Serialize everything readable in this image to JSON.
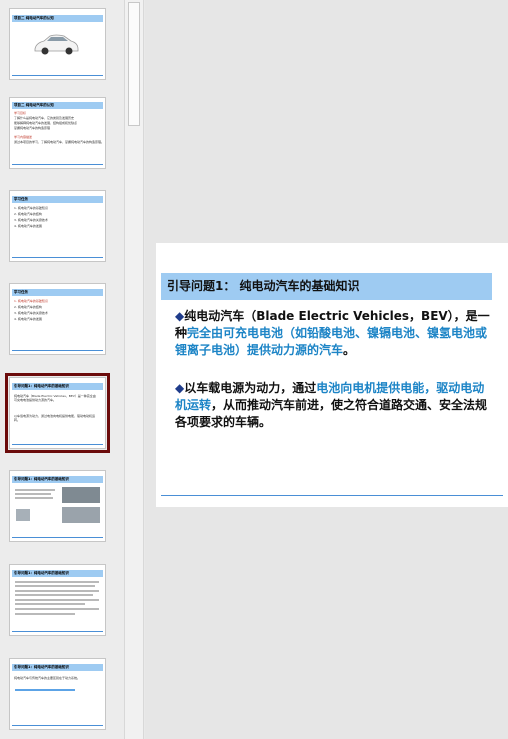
{
  "thumbnails": [
    {
      "title": "项目二 纯电动汽车的认知",
      "bullets": []
    },
    {
      "title": "项目二 纯电动汽车的认知",
      "bullets": [
        "学习目标",
        "了解什么是纯电动汽车、它的类别及发展历史",
        "能够解释纯电动汽车的发展、结构组成和优缺点",
        "掌握纯电动汽车的构造原理",
        "学习内容描述",
        "通过本项目的学习，了解纯电动汽车、掌握纯电动汽车的构造原理。"
      ]
    },
    {
      "title": "学习任务",
      "bullets": [
        "1. 纯电动汽车的基础知识",
        "2. 纯电动汽车的结构",
        "3. 纯电动汽车的关键技术",
        "4. 纯电动汽车的发展"
      ]
    },
    {
      "title": "学习任务",
      "bullets": [
        "1. 纯电动汽车的基础知识",
        "2. 纯电动汽车的结构",
        "3. 纯电动汽车的关键技术",
        "4. 纯电动汽车的发展"
      ]
    },
    {
      "title": "引导问题1：纯电动汽车的基础知识",
      "bullets": [
        "纯电动汽车（Blade Electric Vehicles，BEV）是一种完全由可充电电池提供动力源的汽车。",
        "以车载电源为动力，通过电池向电机提供电能，驱动电动机运转。"
      ]
    },
    {
      "title": "引导问题1：纯电动汽车的基础知识",
      "bullets": []
    },
    {
      "title": "引导问题1：纯电动汽车的基础知识",
      "bullets": []
    },
    {
      "title": "引导问题1：纯电动汽车的基础知识",
      "bullets": [
        "纯电动汽车与传统汽车的主要区别在于动力系统。"
      ]
    }
  ],
  "slide": {
    "title": "引导问题1：  纯电动汽车的基础知识",
    "p1_a": "纯电动汽车（Blade Electric Vehicles，BEV），是一种",
    "p1_b": "完全由可充电电池（如铅酸电池、镍镉电池、镍氢电池或锂离子电池）提供动力源的汽车",
    "p1_c": "。",
    "p2_a": "以车载电源为动力，通过",
    "p2_b": "电池向电机提供电能，驱动电动机运转",
    "p2_c": "，从而推动汽车前进，使之符合道路交通、安全法规各项要求的车辆。"
  },
  "bullet_glyph": "◆",
  "colors": {
    "title_bar": "#9ecbf2",
    "highlight": "#1c84c6",
    "selection": "#6b0b0b"
  }
}
